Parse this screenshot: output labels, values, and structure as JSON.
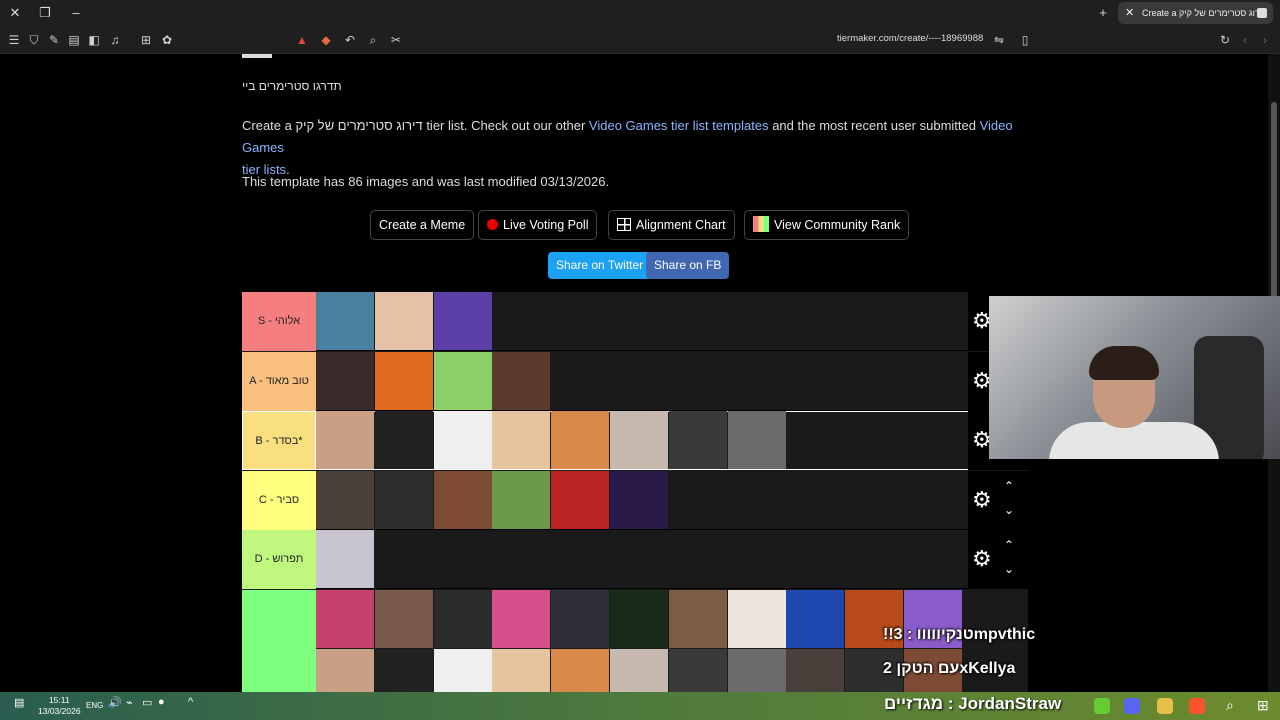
{
  "browser": {
    "tab_title": "Create a דירוג סטרימרים של קיק",
    "url": "tiermaker.com/create/----18969988"
  },
  "page": {
    "heading_fragment": "תדרגו סטרימרים ביי",
    "intro_prefix": "Create a דירוג סטרימרים של קיק tier list. Check out our other",
    "link_templates": "Video Games tier list templates",
    "intro_mid": "and the most recent user submitted",
    "link_lists_1": "Video Games",
    "link_lists_2": "tier lists",
    "intro_end": ".",
    "template_info": "This template has 86 images and was last modified 03/13/2026."
  },
  "actions": {
    "create_meme": "Create a Meme",
    "live_poll": "Live Voting Poll",
    "alignment": "Alignment Chart",
    "community": "View Community Rank",
    "share_twitter": "Share on Twitter",
    "share_fb": "Share on FB"
  },
  "tiers": [
    {
      "label": "S - אלוהי",
      "color": "#f57f7f",
      "count": 3
    },
    {
      "label": "A - טוב מאוד",
      "color": "#f8bf7f",
      "count": 4
    },
    {
      "label": "B - בסדר*",
      "color": "#f9df7f",
      "count": 8
    },
    {
      "label": "C - סביר",
      "color": "#ffff7f",
      "count": 6
    },
    {
      "label": "D - תפרוש",
      "color": "#c0f77f",
      "count": 1
    },
    {
      "label": "",
      "color": "#7fff7f",
      "count": 11
    }
  ],
  "overlay": {
    "chat_1": "!!טנקיווווו : 3mpvthic",
    "chat_2": "עם הטקן 2xKellya",
    "chat_3": "מגדזיים : JordanStraw"
  },
  "taskbar": {
    "time": "15:11",
    "date": "13/03/2026",
    "lang": "ENG"
  }
}
